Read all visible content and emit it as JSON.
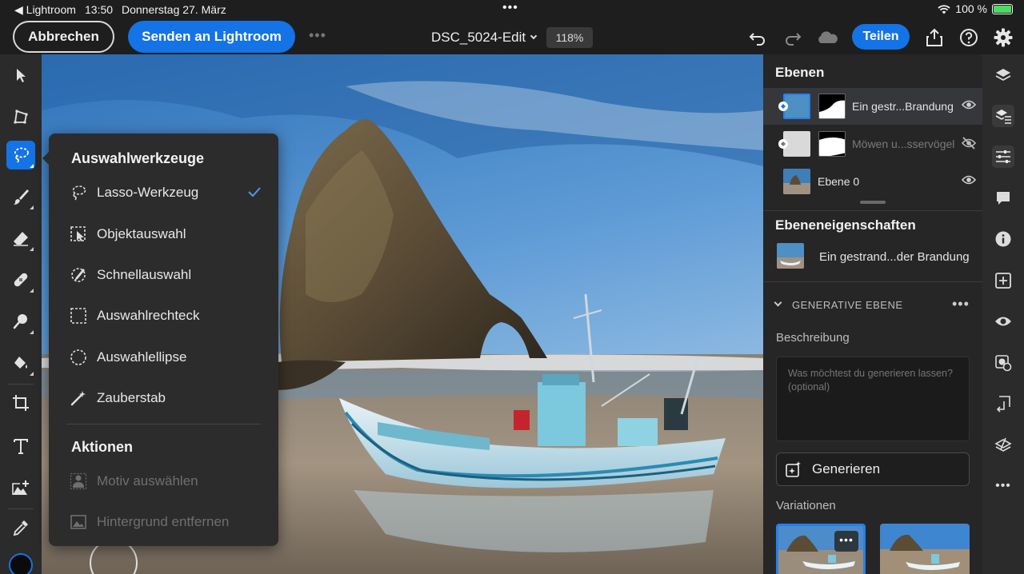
{
  "status_bar": {
    "back_app": "◀ Lightroom",
    "time": "13:50",
    "date": "Donnerstag 27. März",
    "battery": "100 %"
  },
  "toolbar": {
    "cancel_label": "Abbrechen",
    "send_label": "Senden an Lightroom",
    "document_title": "DSC_5024-Edit",
    "zoom_level": "118%",
    "share_label": "Teilen"
  },
  "selection_menu": {
    "heading": "Auswahlwerkzeuge",
    "items": [
      {
        "label": "Lasso-Werkzeug",
        "icon": "lasso-icon",
        "checked": true
      },
      {
        "label": "Objektauswahl",
        "icon": "object-select-icon"
      },
      {
        "label": "Schnellauswahl",
        "icon": "quick-select-icon"
      },
      {
        "label": "Auswahlrechteck",
        "icon": "rect-marquee-icon"
      },
      {
        "label": "Auswahlellipse",
        "icon": "ellipse-marquee-icon"
      },
      {
        "label": "Zauberstab",
        "icon": "magic-wand-icon"
      }
    ],
    "actions_heading": "Aktionen",
    "actions": [
      {
        "label": "Motiv auswählen",
        "icon": "select-subject-icon",
        "disabled": true
      },
      {
        "label": "Hintergrund entfernen",
        "icon": "remove-background-icon",
        "disabled": true
      }
    ]
  },
  "layers_panel": {
    "heading": "Ebenen",
    "layers": [
      {
        "name": "Ein gestr...Brandung",
        "visible": true,
        "selected": true
      },
      {
        "name": "Möwen u...sservögel",
        "visible": false,
        "selected": false
      },
      {
        "name": "Ebene 0",
        "visible": true,
        "selected": false
      }
    ]
  },
  "layer_properties": {
    "heading": "Ebeneneigenschaften",
    "layer_name": "Ein gestrand...der Brandung",
    "section_title": "GENERATIVE EBENE",
    "description_label": "Beschreibung",
    "description_placeholder": "Was möchtest du generieren lassen? (optional)",
    "generate_label": "Generieren",
    "variations_label": "Variationen"
  },
  "colors": {
    "accent": "#1473e6",
    "panel": "#262626",
    "toolbar": "#2b2b2b",
    "popover": "#2c2c2c"
  }
}
